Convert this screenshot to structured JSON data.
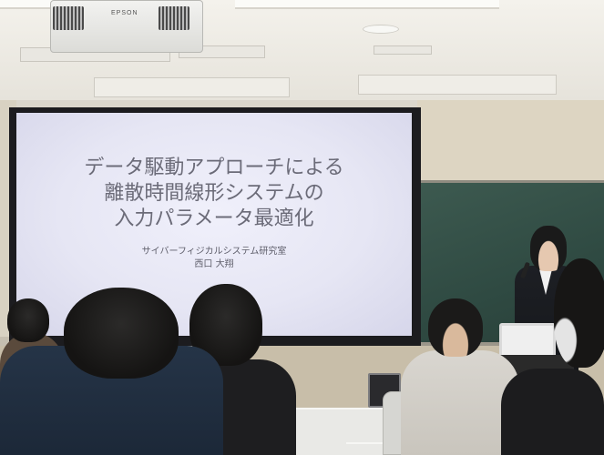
{
  "projector": {
    "brand": "EPSON"
  },
  "slide": {
    "title_lines": [
      "データ駆動アプローチによる",
      "離散時間線形システムの",
      "入力パラメータ最適化"
    ],
    "lab": "サイバーフィジカルシステム研究室",
    "author": "西口 大翔"
  },
  "colors": {
    "screen": "#e8e8f5",
    "slide_text": "#6b6b78",
    "chalkboard": "#2f4a42"
  }
}
